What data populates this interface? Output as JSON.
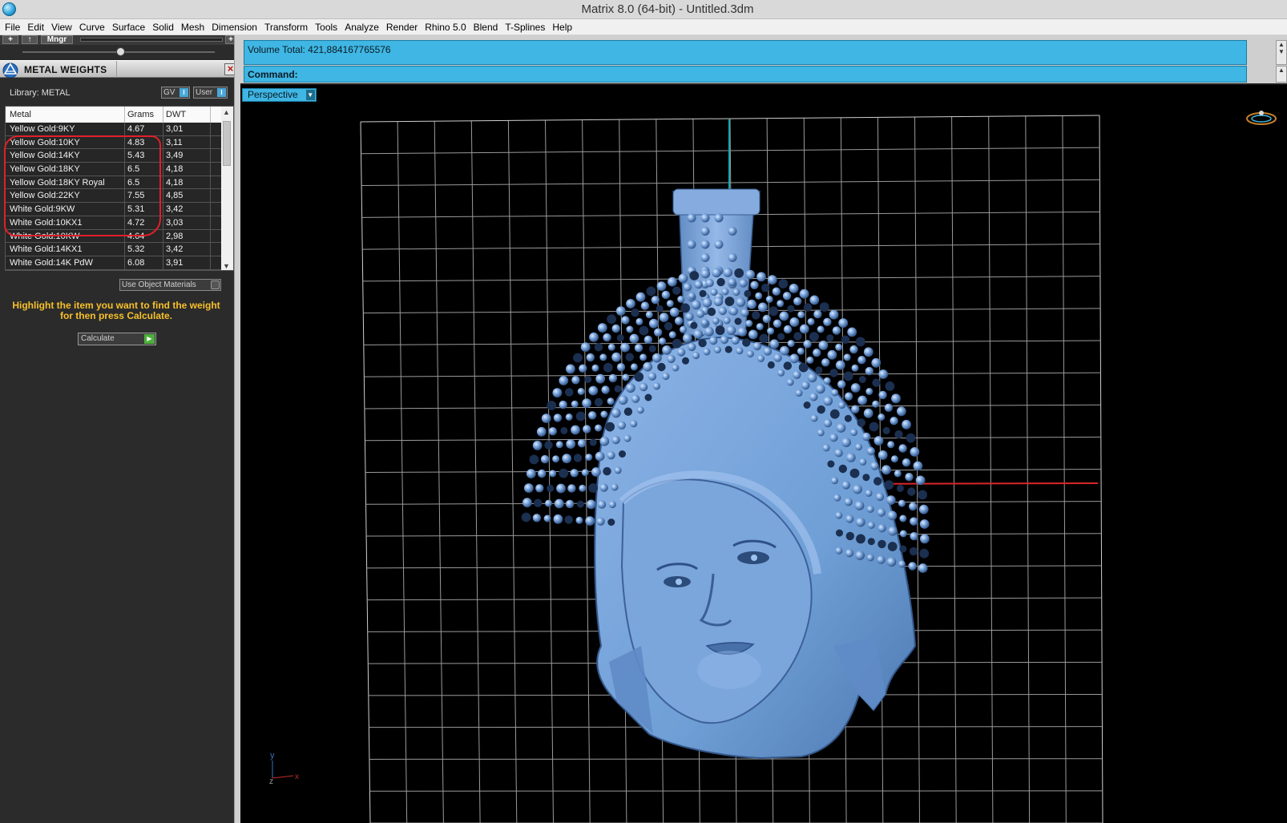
{
  "window": {
    "title": "Matrix 8.0 (64-bit) - Untitled.3dm"
  },
  "menu": [
    {
      "label": "File"
    },
    {
      "label": "Edit"
    },
    {
      "label": "View"
    },
    {
      "label": "Curve"
    },
    {
      "label": "Surface"
    },
    {
      "label": "Solid"
    },
    {
      "label": "Mesh"
    },
    {
      "label": "Dimension"
    },
    {
      "label": "Transform"
    },
    {
      "label": "Tools"
    },
    {
      "label": "Analyze"
    },
    {
      "label": "Render"
    },
    {
      "label": "Rhino 5.0"
    },
    {
      "label": "Blend"
    },
    {
      "label": "T-Splines"
    },
    {
      "label": "Help"
    }
  ],
  "panel": {
    "toolbar": {
      "mngr_label": "Mngr"
    },
    "title": "METAL WEIGHTS",
    "library_label": "Library: METAL",
    "gv_label": "GV",
    "user_label": "User",
    "toggle_glyph": "I",
    "table": {
      "headers": {
        "metal": "Metal",
        "grams": "Grams",
        "dwt": "DWT"
      },
      "rows": [
        {
          "metal": "Yellow Gold:9KY",
          "grams": "4.67",
          "dwt": "3,01"
        },
        {
          "metal": "Yellow Gold:10KY",
          "grams": "4.83",
          "dwt": "3,11"
        },
        {
          "metal": "Yellow Gold:14KY",
          "grams": "5.43",
          "dwt": "3,49"
        },
        {
          "metal": "Yellow Gold:18KY",
          "grams": "6.5",
          "dwt": "4,18"
        },
        {
          "metal": "Yellow Gold:18KY Royal",
          "grams": "6.5",
          "dwt": "4,18"
        },
        {
          "metal": "Yellow Gold:22KY",
          "grams": "7.55",
          "dwt": "4,85"
        },
        {
          "metal": "White Gold:9KW",
          "grams": "5.31",
          "dwt": "3,42"
        },
        {
          "metal": "White Gold:10KX1",
          "grams": "4.72",
          "dwt": "3,03"
        },
        {
          "metal": "White Gold:10KW",
          "grams": "4.64",
          "dwt": "2,98"
        },
        {
          "metal": "White Gold:14KX1",
          "grams": "5.32",
          "dwt": "3,42"
        },
        {
          "metal": "White Gold:14K PdW",
          "grams": "6.08",
          "dwt": "3,91"
        }
      ]
    },
    "use_object_materials": "Use Object Materials",
    "hint": "Highlight the item you want to find the weight for then press Calculate.",
    "calculate_label": "Calculate"
  },
  "command": {
    "volume_text": "Volume Total: 421,884167765576",
    "command_label": "Command:"
  },
  "viewport": {
    "label": "Perspective",
    "axis_y": "y",
    "axis_z": "z",
    "axis_x": "x"
  },
  "colors": {
    "accent": "#3fb6e3",
    "model": "#6f9fd6",
    "hint": "#f7c02b",
    "highlight_ring": "#e0202a"
  }
}
